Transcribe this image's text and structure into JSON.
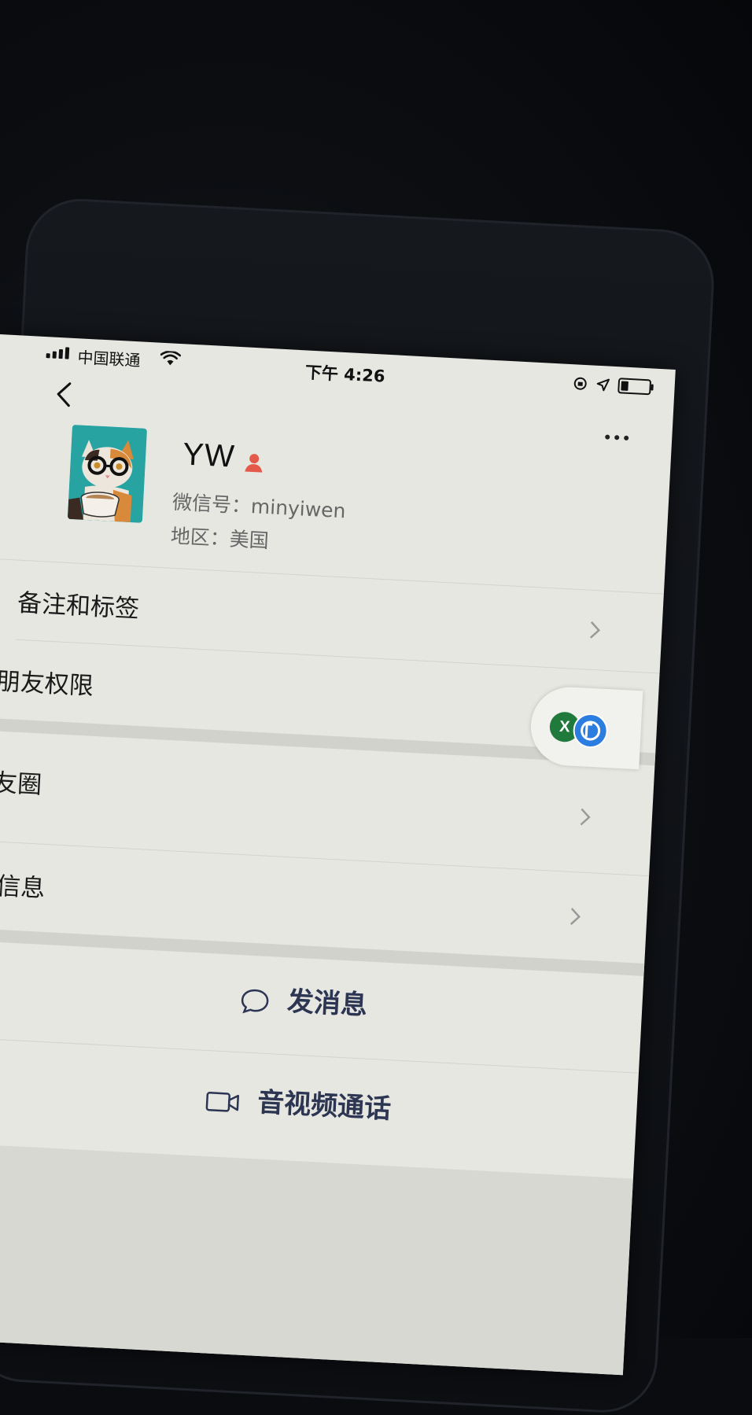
{
  "status_bar": {
    "carrier": "中国联通",
    "time": "下午 4:26"
  },
  "profile": {
    "name": "YW",
    "wechat_id": "微信号：minyiwen",
    "region": "地区：美国",
    "gender_color": "#e35a4a"
  },
  "menu": {
    "items": [
      {
        "label": "备注和标签"
      },
      {
        "label": "朋友权限"
      },
      {
        "label": "朋友圈"
      },
      {
        "label": "更多信息"
      }
    ]
  },
  "actions": {
    "send_message": "发消息",
    "video_call": "音视频通话"
  },
  "colors": {
    "screen_bg": "#e7e7e2",
    "action_text": "#2c3552",
    "x_badge": "#1f7a3b",
    "p_badge": "#2c7de0"
  }
}
